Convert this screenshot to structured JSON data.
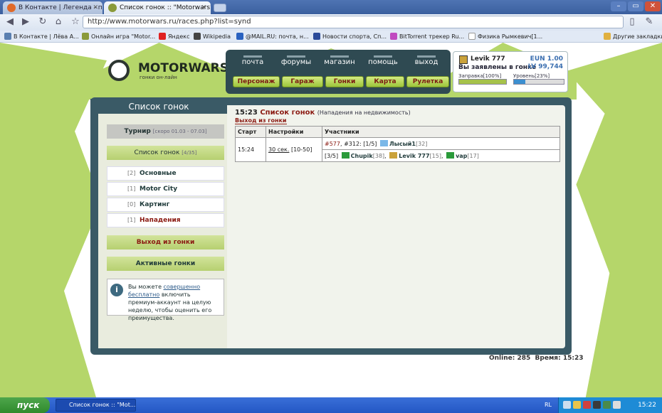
{
  "browser": {
    "tabs": [
      {
        "title": "В Контакте | Легенда - п...",
        "active": false
      },
      {
        "title": "Список гонок :: \"Motorwars\"",
        "active": true
      }
    ],
    "url_prefix": "http://www.motorwars.ru",
    "url_path": "/races.php?list=synd",
    "bookmarks": [
      "В Контакте | Лёва А...",
      "Онлайн игра \"Motor...",
      "Яндекс",
      "Wikipedia",
      "@MAIL.RU: почта, н...",
      "Новости спорта, Сп...",
      "BitTorrent трекер Ru...",
      "Физика Рымкевич[1...",
      "Другие закладки"
    ]
  },
  "site": {
    "logo_text": "MOTORWARS.RU",
    "logo_sub": "гонки он-лайн",
    "top_menu": [
      "почта",
      "форумы",
      "магазин",
      "помощь",
      "выход"
    ],
    "sub_menu": [
      "Персонаж",
      "Гараж",
      "Гонки",
      "Карта",
      "Рулетка"
    ],
    "user": {
      "name": "Levik 777",
      "status": "Вы заявлены в гонке",
      "eun": "EUN 1.00",
      "lv": "LV 99,744",
      "fuel_label": "Заправка[100%]",
      "level_label": "Уровень[23%]",
      "fuel_percent": 100,
      "level_percent": 23
    }
  },
  "sidebar": {
    "title": "Список гонок",
    "tournament": "Турнир",
    "tournament_note": "[скоро 01.03 - 07.03]",
    "race_list": "Список гонок",
    "race_list_count": "[4/35]",
    "items": [
      {
        "count": "[2]",
        "label": "Основные"
      },
      {
        "count": "[1]",
        "label": "Motor City"
      },
      {
        "count": "[0]",
        "label": "Картинг"
      },
      {
        "count": "[1]",
        "label": "Нападения"
      }
    ],
    "exit_race": "Выход из гонки",
    "active_races": "Активные гонки",
    "info_pre": "Вы можете ",
    "info_link": "совершенно бесплатно",
    "info_post": " включить премиум-аккаунт на целую неделю, чтобы оценить его преимущества."
  },
  "main": {
    "time": "15:23",
    "title": "Список гонок",
    "subtitle": "(Нападения на недвижимость)",
    "exit_link": "Выход из гонки",
    "columns": [
      "Старт",
      "Настройки",
      "Участники"
    ],
    "row": {
      "start": "15:24",
      "settings_link": "30 сек.",
      "settings_rest": "[10-50]",
      "race_id": "#577",
      "race_meta": ", #312: [1/5]",
      "opponent": "Лысый1",
      "opponent_level": "[32]",
      "team_count": "[3/5]",
      "participants": [
        {
          "name": "Chupik",
          "level": "[38]"
        },
        {
          "name": "Levik 777",
          "level": "[15]"
        },
        {
          "name": "vap",
          "level": "[17]"
        }
      ]
    }
  },
  "footer": {
    "online": "Online: 285",
    "time": "Время: 15:23"
  },
  "taskbar": {
    "start": "пуск",
    "task": "Список гонок :: \"Mot...",
    "lang": "RL",
    "clock": "15:22"
  }
}
